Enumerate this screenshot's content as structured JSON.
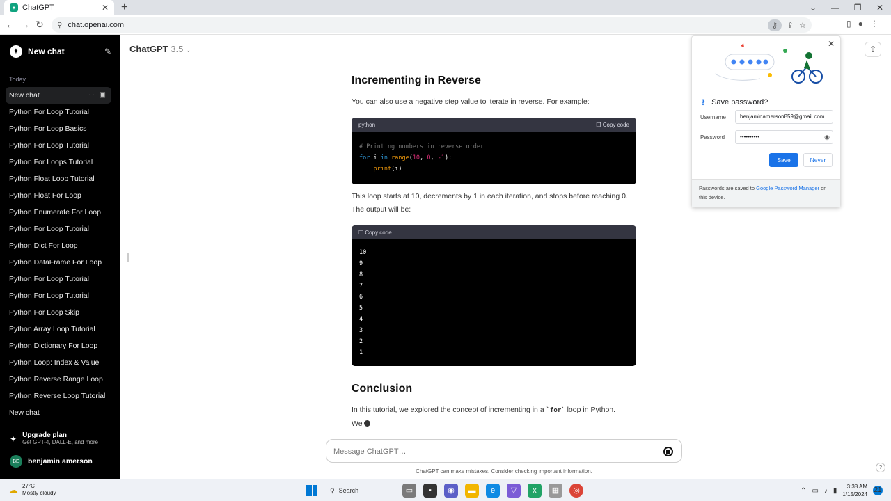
{
  "browser": {
    "tab_title": "ChatGPT",
    "url": "chat.openai.com",
    "win_controls": [
      "⌄",
      "—",
      "❐",
      "✕"
    ]
  },
  "sidebar": {
    "new_chat_label": "New chat",
    "section": "Today",
    "items": [
      {
        "label": "New chat",
        "active": true
      },
      {
        "label": "Python For Loop Tutorial"
      },
      {
        "label": "Python For Loop Basics"
      },
      {
        "label": "Python For Loop Tutorial"
      },
      {
        "label": "Python For Loops Tutorial"
      },
      {
        "label": "Python Float Loop Tutorial"
      },
      {
        "label": "Python Float For Loop"
      },
      {
        "label": "Python Enumerate For Loop"
      },
      {
        "label": "Python For Loop Tutorial"
      },
      {
        "label": "Python Dict For Loop"
      },
      {
        "label": "Python DataFrame For Loop"
      },
      {
        "label": "Python For Loop Tutorial"
      },
      {
        "label": "Python For Loop Tutorial"
      },
      {
        "label": "Python For Loop Skip"
      },
      {
        "label": "Python Array Loop Tutorial"
      },
      {
        "label": "Python Dictionary For Loop"
      },
      {
        "label": "Python Loop: Index & Value"
      },
      {
        "label": "Python Reverse Range Loop"
      },
      {
        "label": "Python Reverse Loop Tutorial"
      },
      {
        "label": "New chat"
      }
    ],
    "upgrade_title": "Upgrade plan",
    "upgrade_sub": "Get GPT-4, DALL·E, and more",
    "user_initials": "BE",
    "user_name": "benjamin amerson"
  },
  "main": {
    "model_name": "ChatGPT",
    "model_version": "3.5",
    "heading1": "Incrementing in Reverse",
    "para1": "You can also use a negative step value to iterate in reverse. For example:",
    "code1_lang": "python",
    "copy_label": "Copy code",
    "code1_comment": "# Printing numbers in reverse order",
    "para2": "This loop starts at 10, decrements by 1 in each iteration, and stops before reaching 0. The output will be:",
    "output_lines": [
      "10",
      "9",
      "8",
      "7",
      "6",
      "5",
      "4",
      "3",
      "2",
      "1"
    ],
    "heading2": "Conclusion",
    "para3_pre": "In this tutorial, we explored the concept of incrementing in a ",
    "para3_code": "`for`",
    "para3_post": " loop in Python.",
    "para3_line2": "We",
    "composer_placeholder": "Message ChatGPT…",
    "disclaimer": "ChatGPT can make mistakes. Consider checking important information.",
    "help": "?"
  },
  "password_popup": {
    "title": "Save password?",
    "username_label": "Username",
    "username_value": "benjaminamerson859@gmail.com",
    "password_label": "Password",
    "password_value": "••••••••••",
    "save_label": "Save",
    "never_label": "Never",
    "footer_pre": "Passwords are saved to ",
    "footer_link": "Google Password Manager",
    "footer_post": " on this device."
  },
  "taskbar": {
    "temp": "27°C",
    "weather": "Mostly cloudy",
    "search_label": "Search",
    "time": "3:38 AM",
    "date": "1/15/2024",
    "notif_count": "21"
  },
  "colors": {
    "accent": "#1a73e8",
    "sidebar_bg": "#000000",
    "code_header": "#343541",
    "brand": "#10a37f"
  }
}
